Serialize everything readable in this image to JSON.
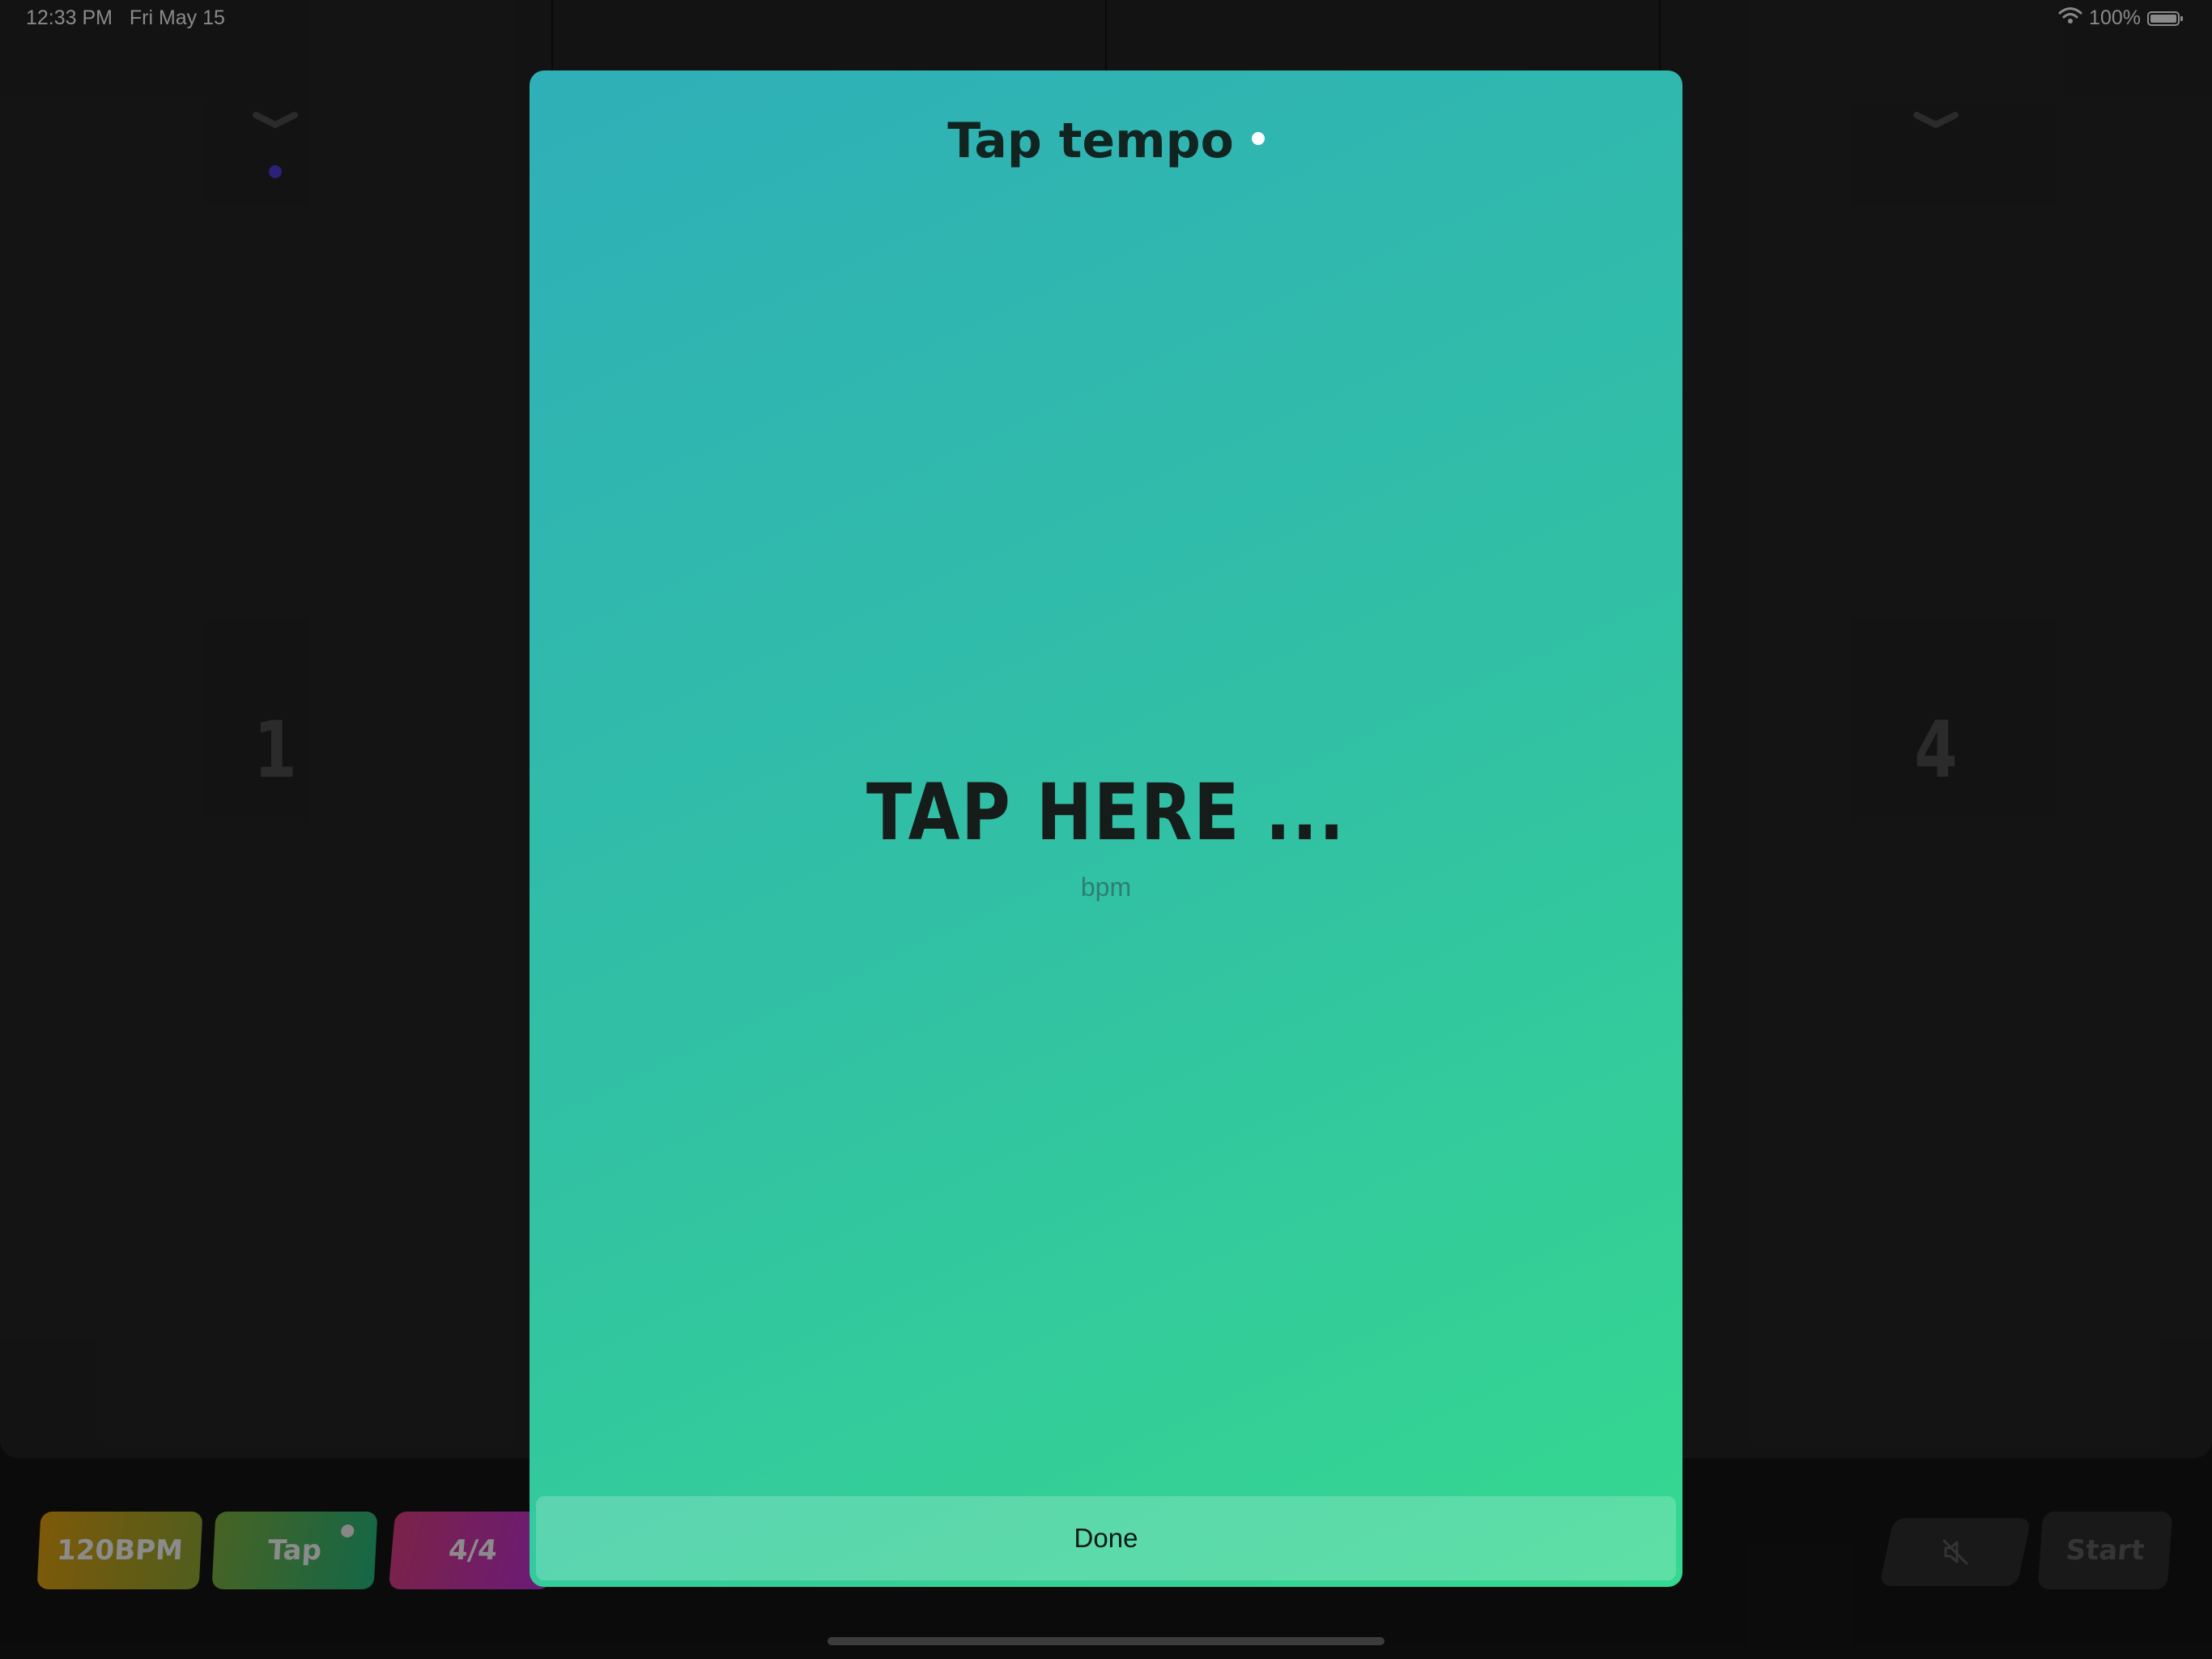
{
  "status_bar": {
    "time": "12:33 PM",
    "date": "Fri May 15",
    "battery": "100%"
  },
  "beats": [
    {
      "number": "1",
      "dot_color": "#4b3ad0"
    },
    {
      "number": "4"
    }
  ],
  "toolbar": {
    "bpm_label": "120BPM",
    "tap_label": "Tap",
    "signature_label": "4/4",
    "start_label": "Start",
    "colors": {
      "bpm": "#c99a1a",
      "tap": "#2faa6e",
      "signature": "#c23aa8"
    }
  },
  "modal": {
    "title": "Tap tempo",
    "prompt": "TAP HERE ...",
    "unit": "bpm",
    "done_label": "Done",
    "gradient": [
      "#2fafb8",
      "#35d88f"
    ]
  }
}
